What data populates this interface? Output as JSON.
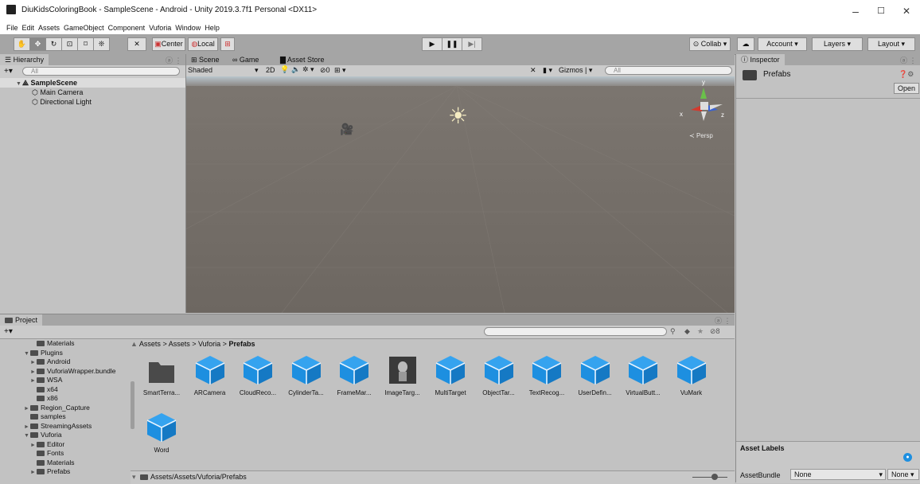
{
  "window": {
    "title": "DiuKidsColoringBook - SampleScene - Android - Unity 2019.3.7f1 Personal <DX11>",
    "controls": [
      "–",
      "☐",
      "✕"
    ]
  },
  "menu": [
    "File",
    "Edit",
    "Assets",
    "GameObject",
    "Component",
    "Vuforia",
    "Window",
    "Help"
  ],
  "toolbar": {
    "pivot": "Center",
    "space": "Local",
    "collab": "Collab",
    "account": "Account",
    "layers": "Layers",
    "layout": "Layout"
  },
  "hierarchy": {
    "tab": "Hierarchy",
    "search_placeholder": "All",
    "scene": "SampleScene",
    "items": [
      "Main Camera",
      "Directional Light"
    ]
  },
  "scene_view": {
    "tabs": [
      "Scene",
      "Game",
      "Asset Store"
    ],
    "shading": "Shaded",
    "mode2d": "2D",
    "hidden_count": "0",
    "gizmos": "Gizmos",
    "search_placeholder": "All",
    "persp": "Persp",
    "axes": {
      "y": "y",
      "x": "x",
      "z": "z"
    }
  },
  "inspector": {
    "tab": "Inspector",
    "title": "Prefabs",
    "open_button": "Open",
    "asset_labels": "Asset Labels",
    "asset_bundle_label": "AssetBundle",
    "asset_bundle_value": "None",
    "variant_value": "None"
  },
  "project": {
    "tab": "Project",
    "count": "8",
    "tree": [
      {
        "label": "Materials",
        "indent": 1,
        "caret": ""
      },
      {
        "label": "Plugins",
        "indent": 0,
        "caret": "▼"
      },
      {
        "label": "Android",
        "indent": 1,
        "caret": "►"
      },
      {
        "label": "VuforiaWrapper.bundle",
        "indent": 1,
        "caret": "►"
      },
      {
        "label": "WSA",
        "indent": 1,
        "caret": "►"
      },
      {
        "label": "x64",
        "indent": 1,
        "caret": ""
      },
      {
        "label": "x86",
        "indent": 1,
        "caret": ""
      },
      {
        "label": "Region_Capture",
        "indent": 0,
        "caret": "►"
      },
      {
        "label": "samples",
        "indent": 0,
        "caret": ""
      },
      {
        "label": "StreamingAssets",
        "indent": 0,
        "caret": "►"
      },
      {
        "label": "Vuforia",
        "indent": 0,
        "caret": "▼"
      },
      {
        "label": "Editor",
        "indent": 1,
        "caret": "►"
      },
      {
        "label": "Fonts",
        "indent": 1,
        "caret": ""
      },
      {
        "label": "Materials",
        "indent": 1,
        "caret": ""
      },
      {
        "label": "Prefabs",
        "indent": 1,
        "caret": "►"
      }
    ],
    "breadcrumb": [
      "Assets",
      "Assets",
      "Vuforia",
      "Prefabs"
    ],
    "assets": [
      {
        "label": "SmartTerra...",
        "kind": "folder"
      },
      {
        "label": "ARCamera",
        "kind": "cube"
      },
      {
        "label": "CloudReco...",
        "kind": "cube"
      },
      {
        "label": "CylinderTa...",
        "kind": "cube"
      },
      {
        "label": "FrameMar...",
        "kind": "cube"
      },
      {
        "label": "ImageTarg...",
        "kind": "image"
      },
      {
        "label": "MultiTarget",
        "kind": "cube"
      },
      {
        "label": "ObjectTar...",
        "kind": "cube"
      },
      {
        "label": "TextRecog...",
        "kind": "cube"
      },
      {
        "label": "UserDefin...",
        "kind": "cube"
      },
      {
        "label": "VirtualButt...",
        "kind": "cube"
      },
      {
        "label": "VuMark",
        "kind": "cube"
      },
      {
        "label": "Word",
        "kind": "cube"
      }
    ],
    "status_path": "Assets/Assets/Vuforia/Prefabs"
  },
  "colors": {
    "accent_blue": "#1d8fe0",
    "toolbar_bg": "#a5a5a5",
    "panel_bg": "#c2c2c2",
    "scene_bg": "#75706a"
  }
}
